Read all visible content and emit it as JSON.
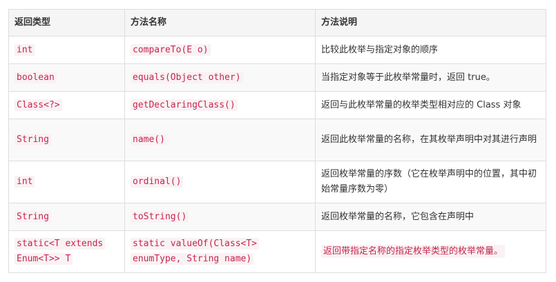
{
  "table": {
    "headers": [
      "返回类型",
      "方法名称",
      "方法说明"
    ],
    "rows": [
      {
        "type": "int",
        "method": "compareTo(E o)",
        "desc": "比较此枚举与指定对象的顺序"
      },
      {
        "type": "boolean",
        "method": "equals(Object other)",
        "desc": "当指定对象等于此枚举常量时，返回 true。"
      },
      {
        "type": "Class<?>",
        "method": "getDeclaringClass()",
        "desc": "返回与此枚举常量的枚举类型相对应的 Class 对象"
      },
      {
        "type": "String",
        "method": "name()",
        "desc": "返回此枚举常量的名称，在其枚举声明中对其进行声明"
      },
      {
        "type": "int",
        "method": "ordinal()",
        "desc": "返回枚举常量的序数（它在枚举声明中的位置，其中初始常量序数为零）"
      },
      {
        "type": "String",
        "method": "toString()",
        "desc": "返回枚举常量的名称，它包含在声明中"
      },
      {
        "type": "static<T extends Enum<T>> T",
        "method": "static valueOf(Class<T> enumType, String name)",
        "desc": "返回带指定名称的指定枚举类型的枚举常量。"
      }
    ]
  }
}
